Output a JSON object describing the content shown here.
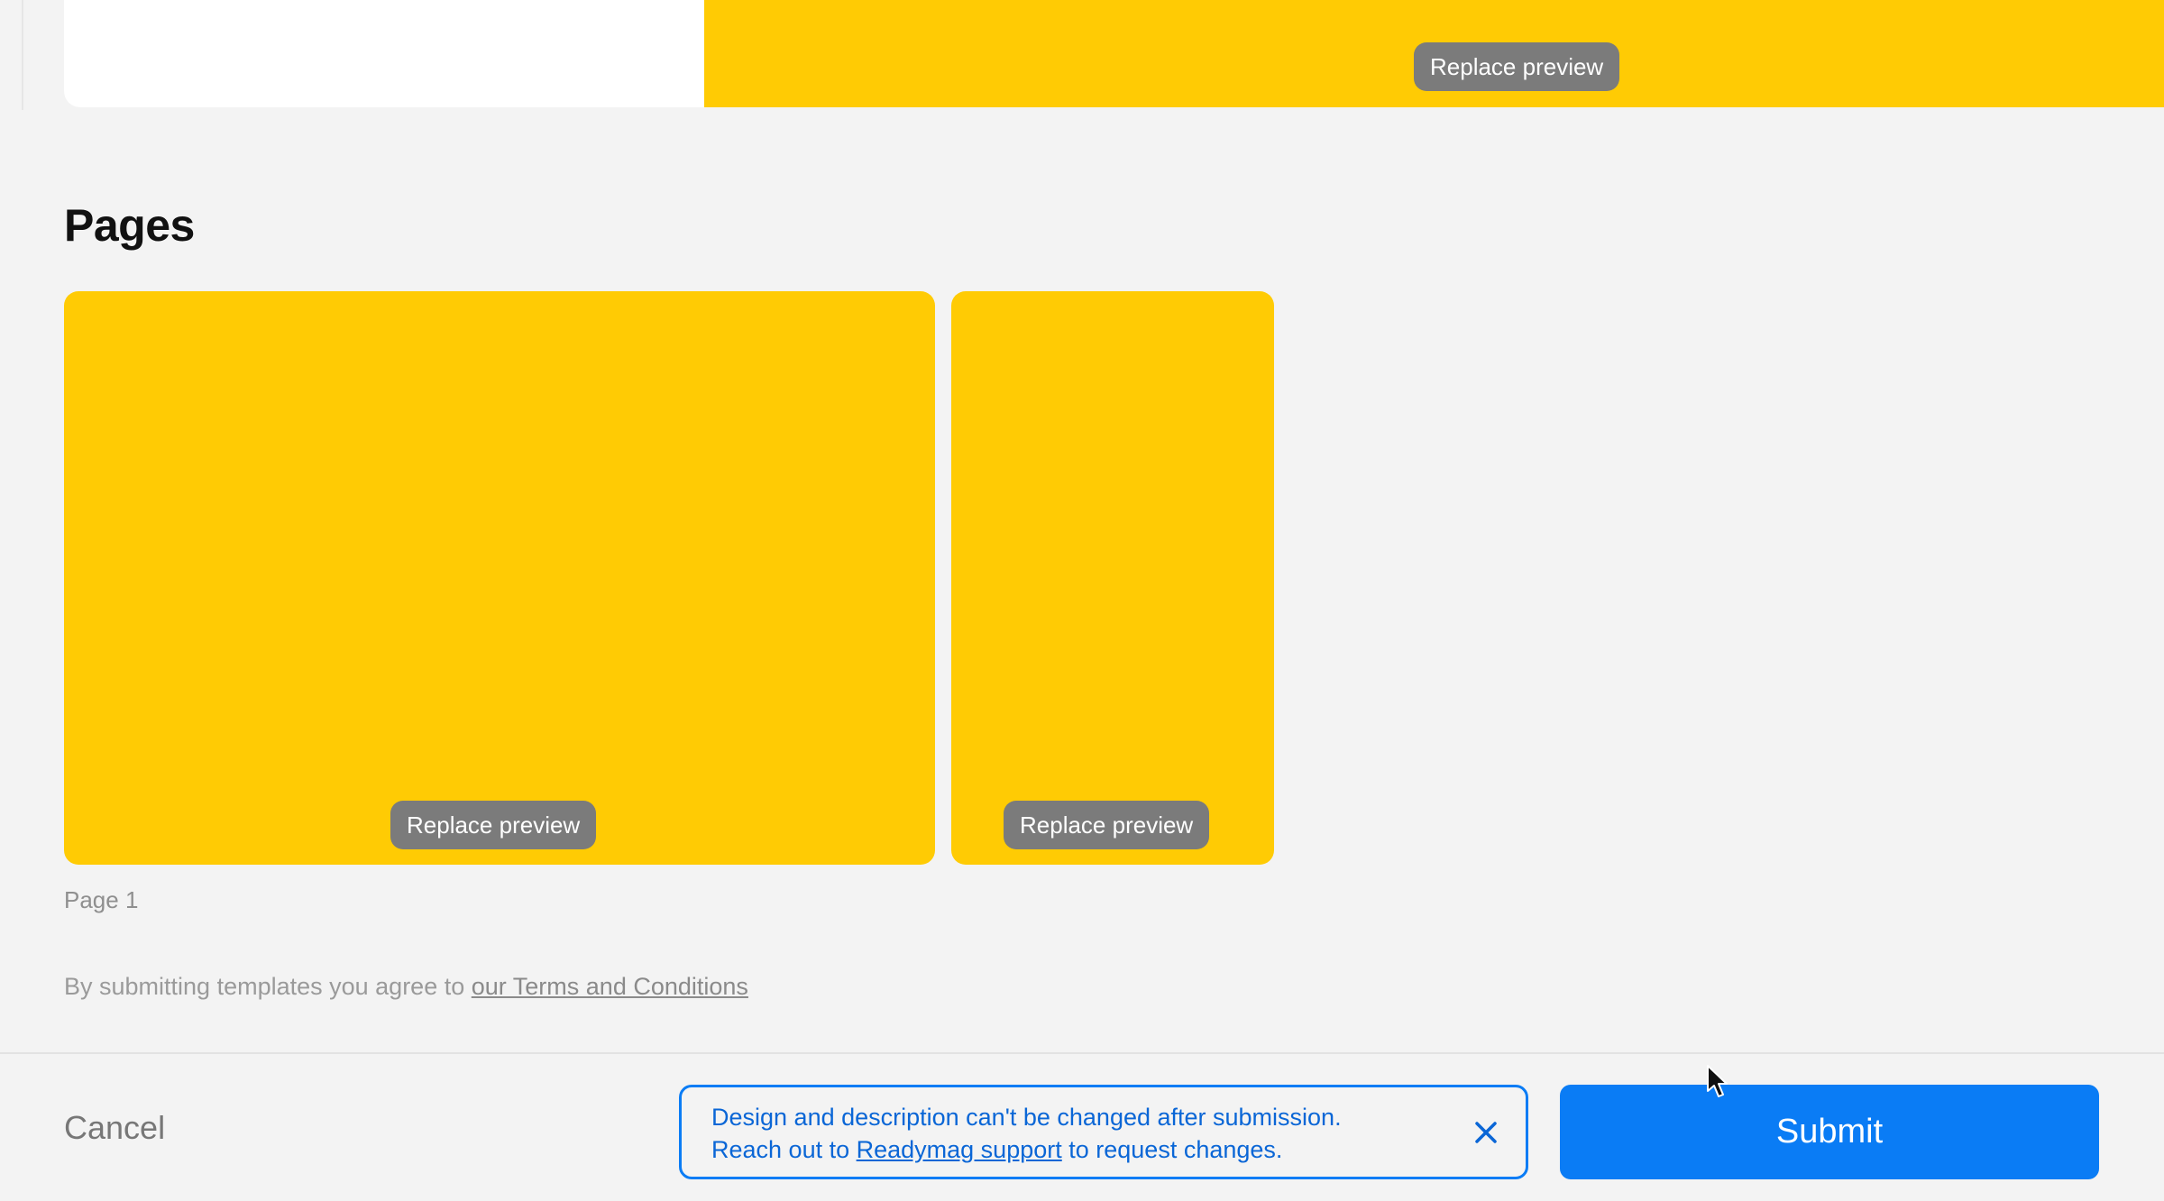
{
  "cover": {
    "replace_label": "Replace preview",
    "preview_color": "#ffcb04"
  },
  "pages": {
    "title": "Pages",
    "items": [
      {
        "replace_label": "Replace preview",
        "label": "Page 1"
      },
      {
        "replace_label": "Replace preview"
      }
    ]
  },
  "terms": {
    "prefix": "By submitting templates you agree to ",
    "link": "our Terms and Conditions"
  },
  "footer": {
    "cancel_label": "Cancel",
    "notice": {
      "line1": "Design and description can't be changed after submission.",
      "line2_prefix": "Reach out to ",
      "link": "Readymag support",
      "line2_suffix": " to request changes.",
      "close_icon": "close-icon"
    },
    "submit_label": "Submit"
  },
  "colors": {
    "accent": "#0a7cf5",
    "preview_yellow": "#ffcb04",
    "background": "#f3f3f3"
  }
}
